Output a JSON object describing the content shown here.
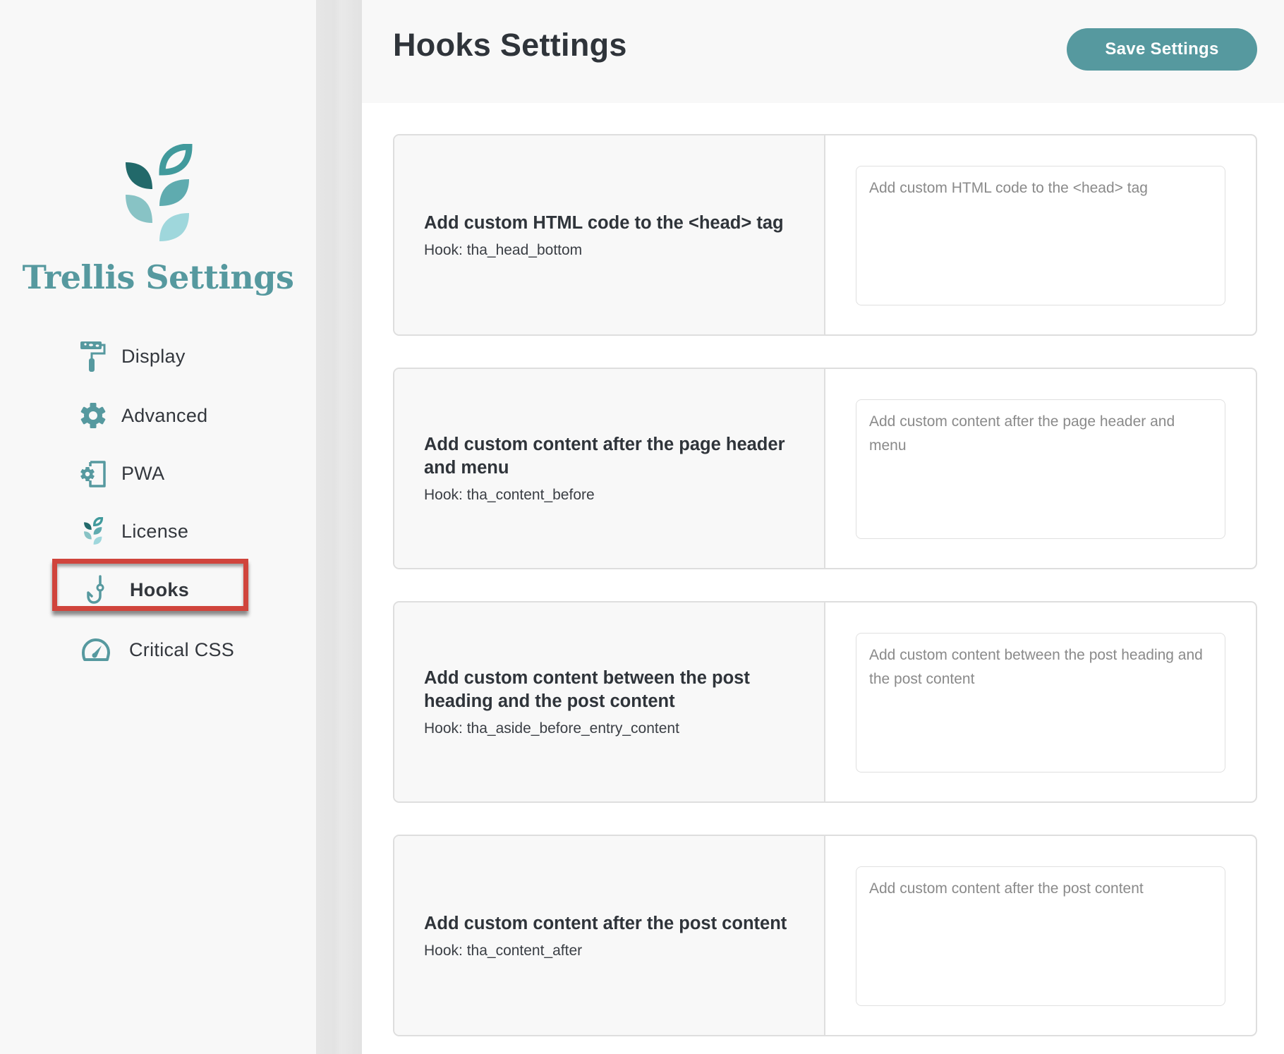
{
  "sidebar": {
    "brand": "Trellis Settings",
    "logo_colors": [
      "#22696a",
      "#419a9c",
      "#5fabaf",
      "#88c3c5",
      "#9fd7dc"
    ],
    "items": [
      {
        "label": "Display",
        "icon": "paint-roller-icon",
        "active": false
      },
      {
        "label": "Advanced",
        "icon": "gear-icon",
        "active": false
      },
      {
        "label": "PWA",
        "icon": "mobile-gear-icon",
        "active": false
      },
      {
        "label": "License",
        "icon": "trellis-leaf-icon",
        "active": false
      },
      {
        "label": "Hooks",
        "icon": "fish-hook-icon",
        "active": true
      },
      {
        "label": "Critical CSS",
        "icon": "speedometer-icon",
        "active": false
      }
    ]
  },
  "header": {
    "title": "Hooks Settings",
    "save_label": "Save Settings"
  },
  "colors": {
    "accent": "#56999f",
    "highlight": "#d0443c",
    "text": "#2f343a"
  },
  "hooks": [
    {
      "title": "Add custom HTML code to the <head> tag",
      "hook": "Hook: tha_head_bottom",
      "placeholder": "Add custom HTML code to the <head> tag",
      "value": ""
    },
    {
      "title": "Add custom content after the page header and menu",
      "hook": "Hook: tha_content_before",
      "placeholder": "Add custom content after the page header and menu",
      "value": ""
    },
    {
      "title": "Add custom content between the post heading and the post content",
      "hook": "Hook: tha_aside_before_entry_content",
      "placeholder": "Add custom content between the post heading and the post content",
      "value": ""
    },
    {
      "title": "Add custom content after the post content",
      "hook": "Hook: tha_content_after",
      "placeholder": "Add custom content after the post content",
      "value": ""
    }
  ]
}
